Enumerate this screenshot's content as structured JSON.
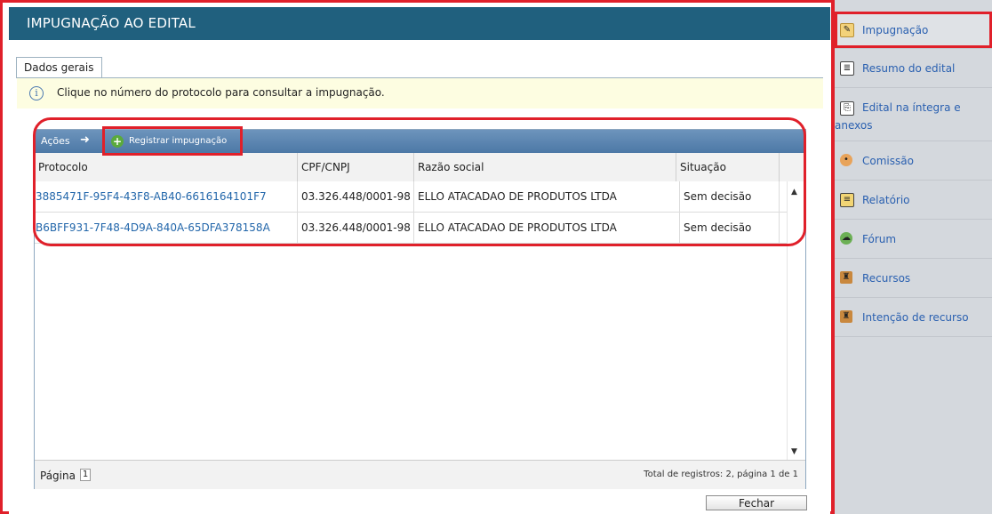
{
  "header": {
    "title": "IMPUGNAÇÃO AO EDITAL"
  },
  "tabs": [
    {
      "label": "Dados gerais"
    }
  ],
  "info": {
    "icon": "info-icon",
    "text": "Clique no número do protocolo para consultar a impugnação."
  },
  "toolbar": {
    "actions_label": "Ações",
    "register_label": "Registrar impugnação"
  },
  "table": {
    "columns": [
      "Protocolo",
      "CPF/CNPJ",
      "Razão social",
      "Situação"
    ],
    "rows": [
      [
        "3885471F-95F4-43F8-AB40-6616164101F7",
        "03.326.448/0001-98",
        "ELLO ATACADAO DE PRODUTOS LTDA",
        "Sem decisão"
      ],
      [
        "B6BFF931-7F48-4D9A-840A-65DFA378158A",
        "03.326.448/0001-98",
        "ELLO ATACADAO DE PRODUTOS LTDA",
        "Sem decisão"
      ]
    ]
  },
  "pagination": {
    "label": "Página",
    "current": "1",
    "total_text": "Total de registros: 2, página 1 de 1"
  },
  "footer": {
    "close_label": "Fechar"
  },
  "sidebar": {
    "items": [
      {
        "label": "Impugnação",
        "icon": "edit-pencil-icon"
      },
      {
        "label": "Resumo do edital",
        "icon": "document-icon"
      },
      {
        "label": "Edital na íntegra e anexos",
        "icon": "attachment-icon"
      },
      {
        "label": "Comissão",
        "icon": "users-icon"
      },
      {
        "label": "Relatório",
        "icon": "report-icon"
      },
      {
        "label": "Fórum",
        "icon": "forum-icon"
      },
      {
        "label": "Recursos",
        "icon": "appeal-icon"
      },
      {
        "label": "Intenção de recurso",
        "icon": "appeal-intent-icon"
      }
    ]
  },
  "colors": {
    "header": "#20607e",
    "toolbar": "#5a86b2",
    "link": "#2266aa",
    "highlight": "#e0202a",
    "sidebar": "#d4d8dd"
  }
}
